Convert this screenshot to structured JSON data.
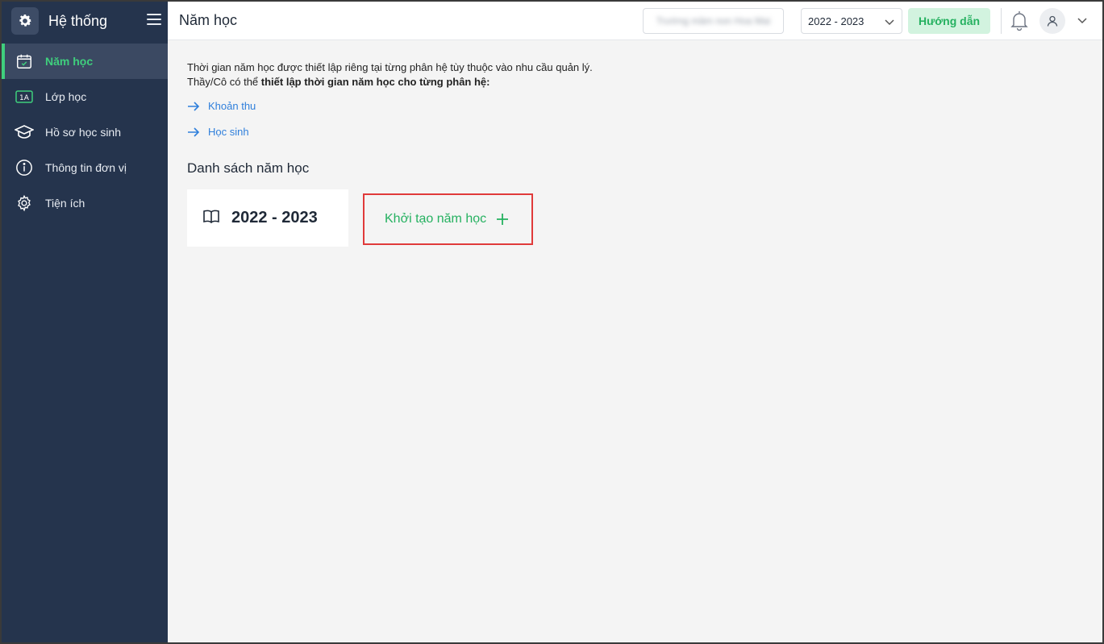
{
  "sidebar": {
    "title": "Hệ thống",
    "items": [
      {
        "label": "Năm học",
        "icon": "calendar-check-icon",
        "active": true
      },
      {
        "label": "Lớp học",
        "icon": "class-1a-icon",
        "badge": "1A"
      },
      {
        "label": "Hồ sơ học sinh",
        "icon": "graduation-cap-icon"
      },
      {
        "label": "Thông tin đơn vị",
        "icon": "info-icon"
      },
      {
        "label": "Tiện ích",
        "icon": "gear-icon"
      }
    ]
  },
  "header": {
    "title": "Năm học",
    "unit_name": "Trường mầm non Hoa Mai",
    "year_select": "2022 - 2023",
    "guide_label": "Hướng dẫn"
  },
  "main": {
    "intro_line1": "Thời gian năm học được thiết lập riêng tại từng phân hệ tùy thuộc vào nhu cầu quản lý.",
    "intro_line2_prefix": "Thầy/Cô có thể ",
    "intro_line2_bold": "thiết lập thời gian năm học cho từng phân hệ:",
    "links": [
      "Khoản thu",
      "Học sinh"
    ],
    "section_title": "Danh sách năm học",
    "year_card": "2022 - 2023",
    "create_label": "Khởi tạo năm học"
  },
  "colors": {
    "sidebar_bg": "#25344d",
    "accent_green": "#3fcf7d",
    "link_blue": "#2f7fdb",
    "highlight_red": "#e03a3a"
  }
}
